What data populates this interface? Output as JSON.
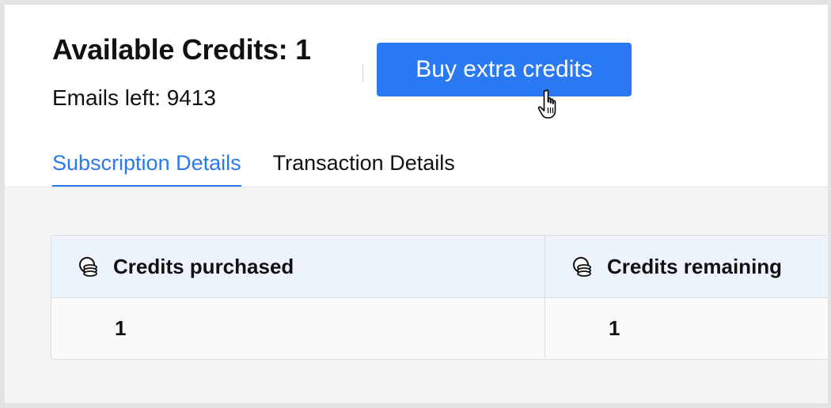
{
  "header": {
    "title": "Available Credits: 1",
    "emails_left": "Emails left: 9413",
    "buy_button_label": "Buy extra credits"
  },
  "tabs": [
    {
      "label": "Subscription Details",
      "active": true
    },
    {
      "label": "Transaction Details",
      "active": false
    }
  ],
  "table": {
    "columns": [
      {
        "label": "Credits purchased",
        "icon": "coins-icon"
      },
      {
        "label": "Credits remaining",
        "icon": "coins-icon"
      }
    ],
    "rows": [
      [
        "1",
        "1"
      ]
    ]
  },
  "colors": {
    "accent": "#2a79f2",
    "table_header_bg": "#edf3fd",
    "content_bg": "#f5f5f5"
  }
}
